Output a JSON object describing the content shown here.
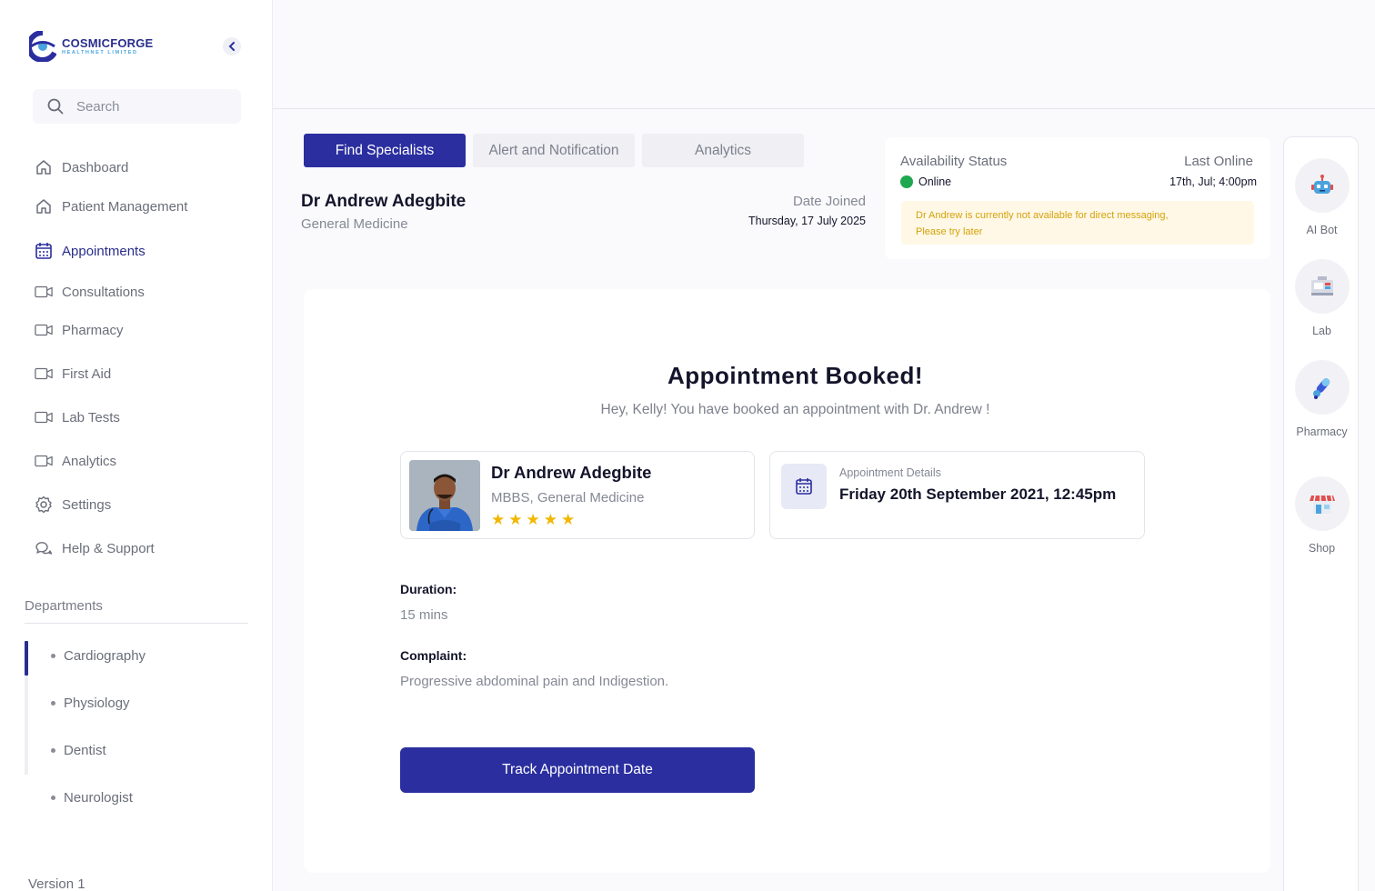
{
  "brand": {
    "name": "COSMICFORGE",
    "tagline": "HEALTHNET LIMITED",
    "primary": "#2a2e9f",
    "accent": "#4aa3df"
  },
  "search": {
    "placeholder": "Search"
  },
  "nav": [
    {
      "label": "Dashboard",
      "icon": "home-icon",
      "active": false
    },
    {
      "label": "Patient Management",
      "icon": "home-icon",
      "active": false
    },
    {
      "label": "Appointments",
      "icon": "calendar-icon",
      "active": true
    },
    {
      "label": "Consultations",
      "icon": "video-icon",
      "active": false
    },
    {
      "label": "Pharmacy",
      "icon": "video-icon",
      "active": false
    },
    {
      "label": "First Aid",
      "icon": "video-icon",
      "active": false
    },
    {
      "label": "Lab Tests",
      "icon": "video-icon",
      "active": false
    },
    {
      "label": "Analytics",
      "icon": "video-icon",
      "active": false
    },
    {
      "label": "Settings",
      "icon": "gear-icon",
      "active": false
    },
    {
      "label": "Help & Support",
      "icon": "chat-icon",
      "active": false
    }
  ],
  "departments": {
    "title": "Departments",
    "items": [
      "Cardiography",
      "Physiology",
      "Dentist",
      "Neurologist"
    ]
  },
  "version": "Version 1",
  "tabs": [
    {
      "label": "Find Specialists",
      "active": true
    },
    {
      "label": "Alert and Notification",
      "active": false
    },
    {
      "label": "Analytics",
      "active": false
    }
  ],
  "doctor": {
    "name": "Dr Andrew Adegbite",
    "specialty": "General Medicine",
    "date_joined_label": "Date Joined",
    "date_joined": "Thursday, 17 July 2025"
  },
  "availability": {
    "status_label": "Availability Status",
    "status": "Online",
    "status_color": "#1fa84f",
    "last_online_label": "Last Online",
    "last_online": "17th, Jul; 4:00pm",
    "notice_line1": "Dr Andrew is currently not available for direct messaging,",
    "notice_line2": "Please try later"
  },
  "rail": [
    {
      "label": "AI Bot",
      "icon": "robot-icon"
    },
    {
      "label": "Lab",
      "icon": "lab-icon"
    },
    {
      "label": "Pharmacy",
      "icon": "pills-icon"
    },
    {
      "label": "Shop",
      "icon": "shop-icon"
    }
  ],
  "booking": {
    "title": "Appointment Booked!",
    "subtitle": "Hey, Kelly! You have booked an  appointment with Dr. Andrew !",
    "doctor_name": "Dr Andrew Adegbite",
    "doctor_credentials": "MBBS, General Medicine",
    "rating": 5,
    "details_label": "Appointment Details",
    "details_value": "Friday 20th September 2021, 12:45pm",
    "duration_label": "Duration:",
    "duration_value": "15 mins",
    "complaint_label": "Complaint:",
    "complaint_value": "Progressive abdominal pain and Indigestion.",
    "button_label": "Track Appointment Date"
  }
}
